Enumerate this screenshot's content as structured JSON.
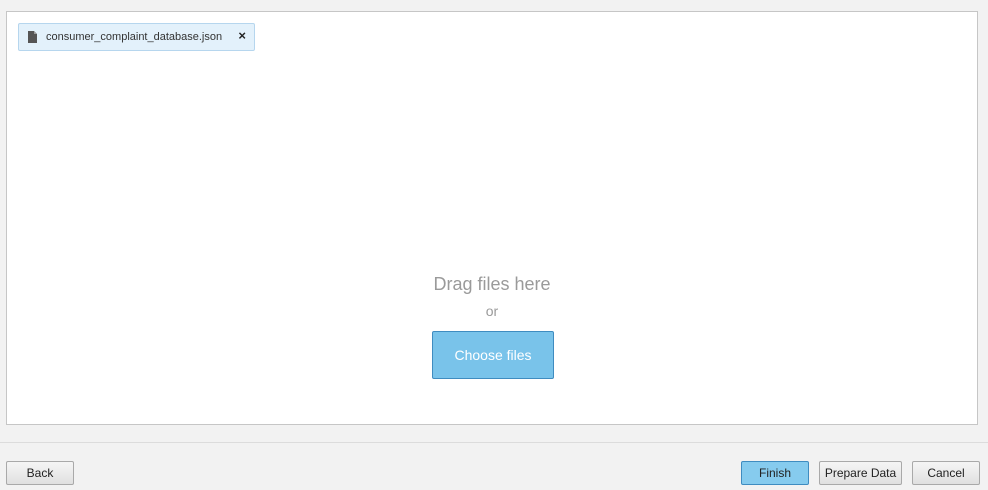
{
  "upload": {
    "file_name": "consumer_complaint_database.json",
    "remove_glyph": "×",
    "drag_text": "Drag files here",
    "or_text": "or",
    "choose_label": "Choose files"
  },
  "footer": {
    "back_label": "Back",
    "finish_label": "Finish",
    "prepare_label": "Prepare Data",
    "cancel_label": "Cancel"
  },
  "colors": {
    "accent": "#79c3ea",
    "chip_bg": "#e3f1fb",
    "muted_text": "#9a9a9a"
  },
  "icons": {
    "file": "document-icon",
    "remove": "close-icon"
  }
}
